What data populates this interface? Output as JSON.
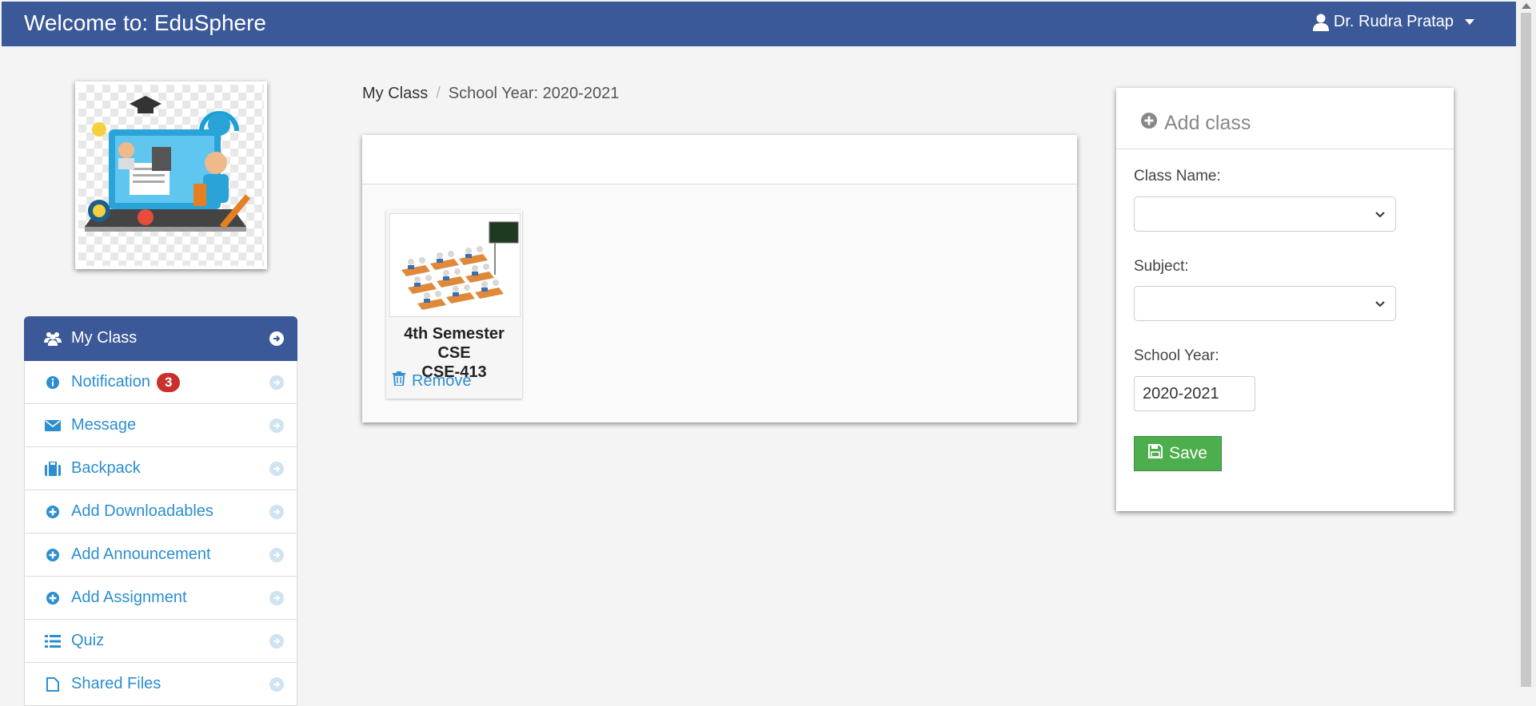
{
  "header": {
    "brand": "Welcome to: EduSphere",
    "user_name": "Dr. Rudra Pratap"
  },
  "breadcrumb": {
    "link": "My Class",
    "separator": "/",
    "current": "School Year: 2020-2021"
  },
  "sidebar": {
    "items": [
      {
        "label": "My Class",
        "icon": "users-icon",
        "active": true
      },
      {
        "label": "Notification",
        "icon": "info-icon",
        "badge": "3"
      },
      {
        "label": "Message",
        "icon": "envelope-icon"
      },
      {
        "label": "Backpack",
        "icon": "briefcase-icon"
      },
      {
        "label": "Add Downloadables",
        "icon": "plus-circle-icon"
      },
      {
        "label": "Add Announcement",
        "icon": "plus-circle-icon"
      },
      {
        "label": "Add Assignment",
        "icon": "plus-circle-icon"
      },
      {
        "label": "Quiz",
        "icon": "list-icon"
      },
      {
        "label": "Shared Files",
        "icon": "file-icon"
      }
    ]
  },
  "classes": [
    {
      "name_line1": "4th Semester CSE",
      "name_line2": "CSE-413",
      "remove_label": "Remove"
    }
  ],
  "add_class": {
    "title": "Add class",
    "class_name_label": "Class Name:",
    "subject_label": "Subject:",
    "school_year_label": "School Year:",
    "school_year_value": "2020-2021",
    "save_label": "Save"
  },
  "colors": {
    "header_bg": "#3b5998",
    "link": "#2c8ed0",
    "save_bg": "#4cae4c",
    "badge_bg": "#c9302c"
  }
}
